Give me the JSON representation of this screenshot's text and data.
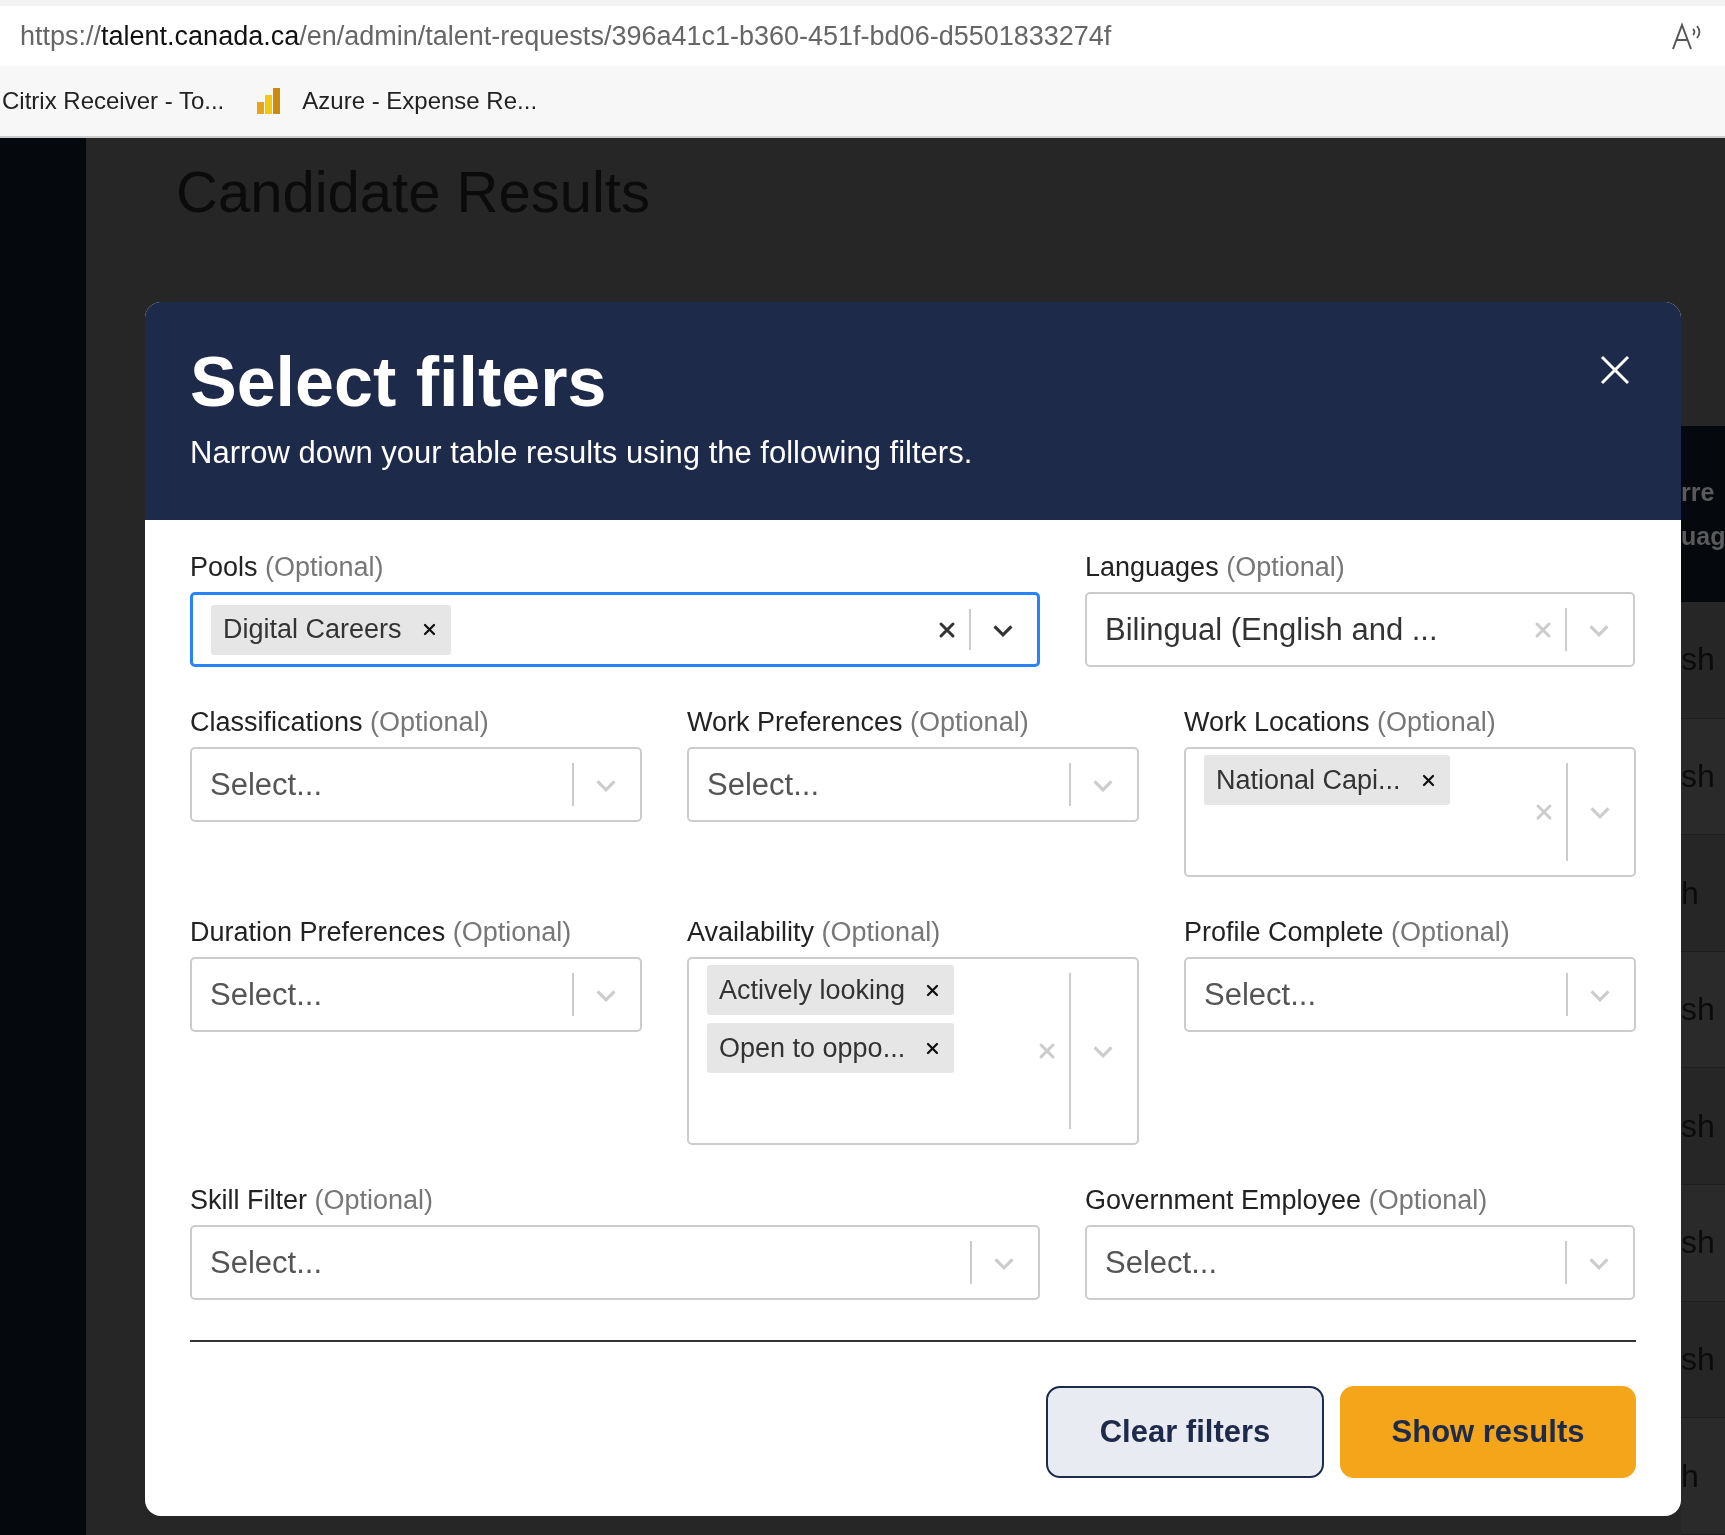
{
  "browser": {
    "url_scheme": "https://",
    "url_host": "talent.canada.ca",
    "url_path": "/en/admin/talent-requests/396a41c1-b360-451f-bd06-d5501833274f",
    "bookmarks": [
      {
        "label": "Citrix Receiver - To...",
        "kind": "plain"
      },
      {
        "label": "Azure - Expense Re...",
        "kind": "chart"
      }
    ]
  },
  "page": {
    "heading": "Candidate Results",
    "table_header": [
      "rre",
      "uag"
    ],
    "table_rows": [
      "sh",
      "sh",
      "h",
      "sh",
      "sh",
      "sh",
      "sh",
      "h"
    ]
  },
  "dialog": {
    "title": "Select filters",
    "subtitle": "Narrow down your table results using the following filters.",
    "rows": [
      [
        {
          "label": "Pools",
          "hint": "(Optional)",
          "focused": true,
          "chips": [
            "Digital Careers"
          ]
        },
        {
          "label": "Languages",
          "hint": "(Optional)",
          "focused": false,
          "value": "Bilingual (English and ..."
        }
      ],
      [
        {
          "label": "Classifications",
          "hint": "(Optional)",
          "focused": false,
          "placeholder": "Select..."
        },
        {
          "label": "Work Preferences",
          "hint": "(Optional)",
          "focused": false,
          "placeholder": "Select..."
        },
        {
          "label": "Work Locations",
          "hint": "(Optional)",
          "focused": false,
          "chips": [
            "National Capi..."
          ]
        }
      ],
      [
        {
          "label": "Duration Preferences",
          "hint": "(Optional)",
          "focused": false,
          "placeholder": "Select..."
        },
        {
          "label": "Availability",
          "hint": "(Optional)",
          "focused": false,
          "chips": [
            "Actively looking",
            "Open to oppo..."
          ]
        },
        {
          "label": "Profile Complete",
          "hint": "(Optional)",
          "focused": false,
          "placeholder": "Select..."
        }
      ],
      [
        {
          "label": "Skill Filter",
          "hint": "(Optional)",
          "focused": false,
          "placeholder": "Select..."
        },
        {
          "label": "Government Employee",
          "hint": "(Optional)",
          "focused": false,
          "placeholder": "Select..."
        }
      ]
    ],
    "buttons": [
      {
        "label": "Clear filters",
        "kind": "secondary"
      },
      {
        "label": "Show results",
        "kind": "primary"
      }
    ]
  }
}
